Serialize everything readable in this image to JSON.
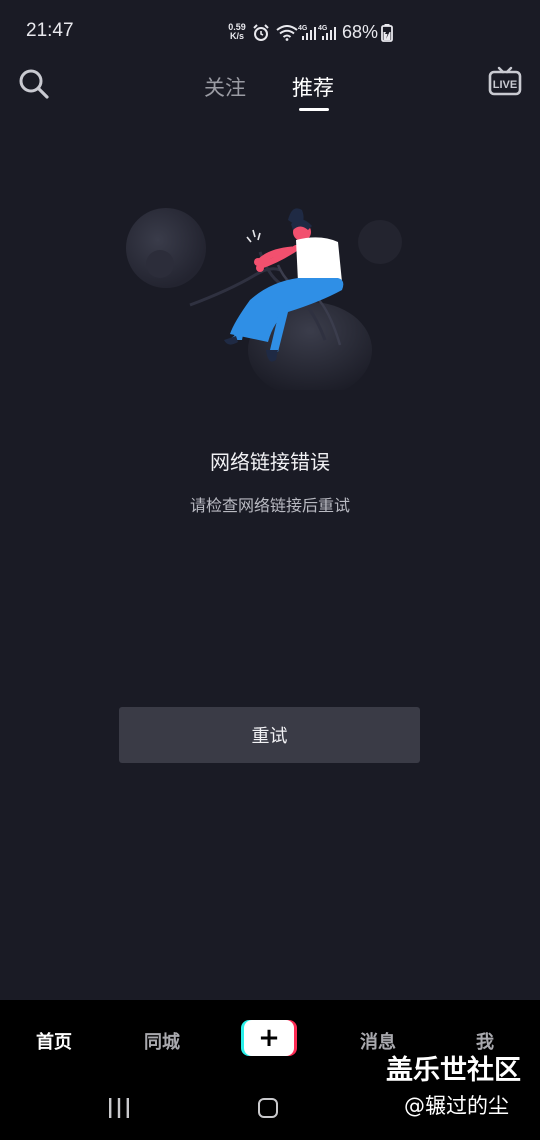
{
  "status_bar": {
    "time": "21:47",
    "net_speed_value": "0.59",
    "net_speed_unit": "K/s",
    "battery": "68%",
    "icons": [
      "alarm-icon",
      "wifi-icon",
      "signal-4g-icon",
      "signal-4g-icon",
      "battery-charging-icon"
    ]
  },
  "top_nav": {
    "tabs": [
      {
        "label": "关注",
        "active": false
      },
      {
        "label": "推荐",
        "active": true
      }
    ],
    "search_icon": "search-icon",
    "live_label": "LIVE"
  },
  "error": {
    "title": "网络链接错误",
    "subtitle": "请检查网络链接后重试",
    "retry_label": "重试"
  },
  "bottom_nav": {
    "items": [
      {
        "label": "首页",
        "active": true
      },
      {
        "label": "同城",
        "active": false
      },
      {
        "label": "+",
        "active": false
      },
      {
        "label": "消息",
        "active": false
      },
      {
        "label": "我",
        "active": false
      }
    ]
  },
  "watermark": {
    "line1": "盖乐世社区",
    "line2": "@辗过的尘"
  },
  "colors": {
    "background": "#1a1b25",
    "retry_button": "#3a3b46",
    "brand_cyan": "#2af0ea",
    "brand_red": "#fe2c55",
    "illustration_blue": "#2f8fe6",
    "illustration_pink": "#f2506e"
  }
}
